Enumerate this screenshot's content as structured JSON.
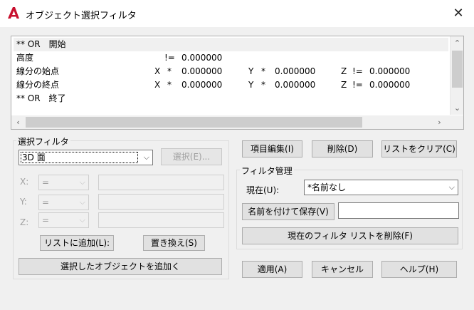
{
  "window": {
    "title": "オブジェクト選択フィルタ",
    "close_label": "✕"
  },
  "filter_list": {
    "rows": [
      {
        "a": "** OR　開始",
        "b": "",
        "c": "",
        "d": "",
        "e": "",
        "f": "",
        "g": "",
        "h": "",
        "i": ""
      },
      {
        "a": "高度",
        "b": "",
        "c": "!=",
        "d": "0.000000",
        "e": "",
        "f": "",
        "g": "",
        "h": "",
        "i": ""
      },
      {
        "a": "線分の始点",
        "b": "X",
        "c": "*",
        "d": "0.000000",
        "e": "Y",
        "f": "*",
        "g": "0.000000",
        "h": "Z",
        "i": "!=",
        "j": "0.000000"
      },
      {
        "a": "線分の終点",
        "b": "X",
        "c": "*",
        "d": "0.000000",
        "e": "Y",
        "f": "*",
        "g": "0.000000",
        "h": "Z",
        "i": "!=",
        "j": "0.000000"
      },
      {
        "a": "** OR　終了",
        "b": "",
        "c": "",
        "d": "",
        "e": "",
        "f": "",
        "g": "",
        "h": "",
        "i": ""
      }
    ]
  },
  "select_filter": {
    "group_label": "選択フィルタ",
    "type_value": "3D 面",
    "select_button": "選択(E)...",
    "x_label": "X:",
    "y_label": "Y:",
    "z_label": "Z:",
    "op_value": "=",
    "add_to_list_button": "リストに追加(L):",
    "replace_button": "置き換え(S)",
    "add_selected_button": "選択したオブジェクトを追加く"
  },
  "edit_buttons": {
    "edit_item": "項目編集(I)",
    "delete": "削除(D)",
    "clear_list": "リストをクリア(C)"
  },
  "filter_management": {
    "group_label": "フィルタ管理",
    "current_label": "現在(U):",
    "current_value": "*名前なし",
    "save_as_button": "名前を付けて保存(V)",
    "save_as_value": "",
    "delete_current_button": "現在のフィルタ リストを削除(F)"
  },
  "footer": {
    "apply": "適用(A)",
    "cancel": "キャンセル",
    "help": "ヘルプ(H)"
  },
  "colors": {
    "app_icon": "#c8102e"
  }
}
